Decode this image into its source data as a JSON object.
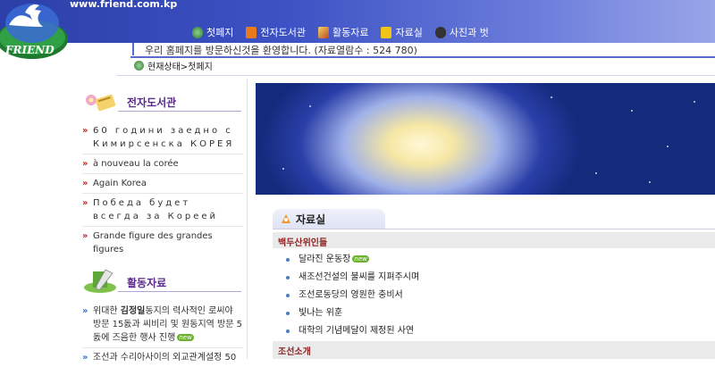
{
  "header": {
    "url": "www.friend.com.kp",
    "logo_text": "FRIEND",
    "nav": [
      {
        "label": "첫페지",
        "icon": "globe-icon"
      },
      {
        "label": "전자도서관",
        "icon": "book-icon"
      },
      {
        "label": "활동자료",
        "icon": "pen-icon"
      },
      {
        "label": "자료실",
        "icon": "folder-icon"
      },
      {
        "label": "사진과 벗",
        "icon": "camera-icon"
      }
    ]
  },
  "welcome": "우리 홈페지를 방문하신것을 환영합니다.   (자료열람수 : 524 780)",
  "breadcrumb": "현재상태>첫페지",
  "sidebar": {
    "library": {
      "title": "전자도서관",
      "items": [
        "60 години заедно с Кимирсенска КОРЕЯ",
        "à nouveau la corée",
        "Again Korea",
        "Победа будет всегда за Кореей",
        "Grande figure des grandes figures"
      ]
    },
    "activity": {
      "title": "활동자료",
      "items": [
        {
          "prefix": "위대한 ",
          "bold": "김정일",
          "rest": "동지의 력사적인 로씨야 방문 15돐과 씨비리 및 원동지역 방문 5돐에 즈음한 행사 진행"
        },
        {
          "prefix": "조선과 수리아사이의 외교관계설정 50",
          "bold": "",
          "rest": ""
        }
      ]
    }
  },
  "resources": {
    "tab_title": "자료실",
    "category1": "백두산위인들",
    "items": [
      {
        "text": "달라진 운동장",
        "new": true
      },
      {
        "text": "새조선건설의 불씨를 지펴주시며",
        "new": false
      },
      {
        "text": "조선로동당의 영원한 충비서",
        "new": false
      },
      {
        "text": "빛나는 위훈",
        "new": false
      },
      {
        "text": "대학의 기념메달이 제정된 사연",
        "new": false
      }
    ],
    "category2": "조선소개",
    "new_badge": "new"
  },
  "colors": {
    "header_blue": "#3d52c4",
    "accent_purple": "#5b2a8a",
    "category_red": "#8a1f1f"
  }
}
